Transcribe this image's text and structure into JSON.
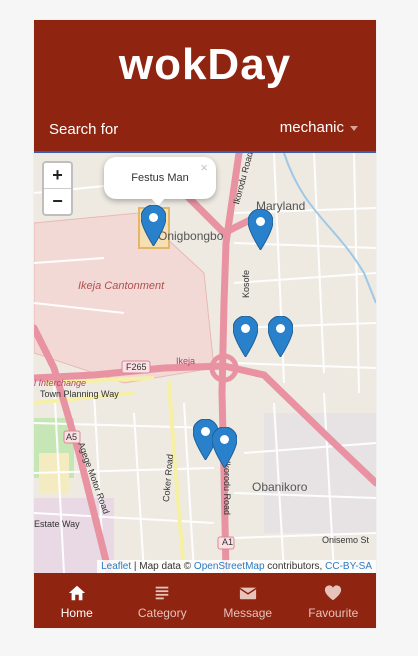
{
  "app": {
    "title": "wokDay"
  },
  "search": {
    "label": "Search for",
    "selected": "mechanic"
  },
  "map": {
    "popup": {
      "text": "Festus Man",
      "close": "×"
    },
    "zoom": {
      "in": "+",
      "out": "−"
    },
    "labels": {
      "maryland": "Maryland",
      "onigbongbo": "Onigbongbo",
      "ikeja_cantonment": "Ikeja Cantonment",
      "f265": "F265",
      "ikeja": "Ikeja",
      "interchange": "i Interchange",
      "town_planning": "Town Planning Way",
      "a5": "A5",
      "agege": "Agege Motor Road",
      "coker": "Coker Road",
      "ikorodu_south": "Ikorodu Road",
      "ikorodu_north": "Ikorodu Road",
      "obanikoro": "Obanikoro",
      "a1": "A1",
      "onisemo": "Onisemo St",
      "kosofe": "Kosofe",
      "estate_way": "Estate Way"
    },
    "attribution": {
      "leaflet": "Leaflet",
      "sep": " | Map data © ",
      "osm": "OpenStreetMap",
      "contrib": " contributors, ",
      "license": "CC-BY-SA"
    }
  },
  "tabs": [
    {
      "label": "Home",
      "icon": "home-icon"
    },
    {
      "label": "Category",
      "icon": "list-icon"
    },
    {
      "label": "Message",
      "icon": "envelope-icon"
    },
    {
      "label": "Favourite",
      "icon": "heart-icon"
    }
  ],
  "colors": {
    "brand": "#8f2410",
    "marker": "#2a81cb",
    "road_major": "#e892a2"
  }
}
